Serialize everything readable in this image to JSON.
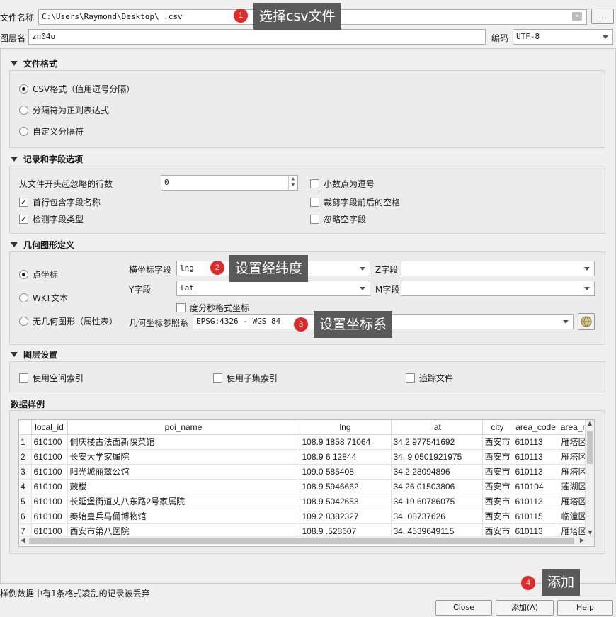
{
  "file_row": {
    "label": "文件名称",
    "path": "C:\\Users\\Raymond\\Desktop\\                 .csv",
    "browse_label": "…"
  },
  "layer_row": {
    "label": "图层名",
    "value": "          zn04o",
    "encoding_label": "编码",
    "encoding_value": "UTF-8"
  },
  "file_format": {
    "title": "文件格式",
    "options": [
      "CSV格式（值用逗号分隔）",
      "分隔符为正则表达式",
      "自定义分隔符"
    ],
    "selected": 0
  },
  "record_options": {
    "title": "记录和字段选项",
    "skip_label": "从文件开头起忽略的行数",
    "skip_value": "0",
    "first_row_header": "首行包含字段名称",
    "detect_types": "检测字段类型",
    "decimal_comma": "小数点为逗号",
    "trim_fields": "裁剪字段前后的空格",
    "discard_empty": "忽略空字段"
  },
  "geometry": {
    "title": "几何图形定义",
    "point_label": "点坐标",
    "wkt_label": "WKT文本",
    "none_label": "无几何图形（属性表）",
    "x_label": "横坐标字段",
    "x_value": "lng",
    "y_label": "Y字段",
    "y_value": "lat",
    "z_label": "Z字段",
    "m_label": "M字段",
    "dms_label": "度分秒格式坐标",
    "crs_label": "几何坐标参照系",
    "crs_value": "EPSG:4326 - WGS 84"
  },
  "layer_settings": {
    "title": "图层设置",
    "spatial_index": "使用空间索引",
    "subset_index": "使用子集索引",
    "watch_file": "追踪文件"
  },
  "sample": {
    "title": "数据样例",
    "columns": [
      "",
      "local_id",
      "poi_name",
      "lng",
      "lat",
      "city",
      "area_code",
      "area_n"
    ],
    "rows": [
      [
        "1",
        "610100",
        "侗庆楼古法面新陕菜馆",
        "108.9   1858  71064",
        "34.2    977541692",
        "西安市",
        "610113",
        "雁塔区"
      ],
      [
        "2",
        "610100",
        "长安大学家属院",
        "108.9      6  12844",
        "34.   9  0501921975",
        "西安市",
        "610113",
        "雁塔区"
      ],
      [
        "3",
        "610100",
        "阳光城丽兹公馆",
        "109.0     585408",
        "34.2    28094896",
        "西安市",
        "610113",
        "雁塔区"
      ],
      [
        "4",
        "610100",
        "鼓楼",
        "108.9     5946662",
        "34.26   01503806",
        "西安市",
        "610104",
        "莲湖区"
      ],
      [
        "5",
        "610100",
        "长延堡街道丈八东路2号家属院",
        "108.9     5042653",
        "34.19    60786075",
        "西安市",
        "610113",
        "雁塔区"
      ],
      [
        "6",
        "610100",
        "秦始皇兵马俑博物馆",
        "109.2     8382327",
        "34.    08737626",
        "西安市",
        "610115",
        "临潼区"
      ],
      [
        "7",
        "610100",
        "西安市第八医院",
        "108.9     .528607",
        "34.    4539649115",
        "西安市",
        "610113",
        "雁塔区"
      ]
    ]
  },
  "status_text": "样例数据中有1条格式凌乱的记录被丢弃",
  "buttons": {
    "close": "Close",
    "add": "添加(A)",
    "help": "Help"
  },
  "annotations": [
    {
      "num": "1",
      "text": "选择csv文件"
    },
    {
      "num": "2",
      "text": "设置经纬度"
    },
    {
      "num": "3",
      "text": "设置坐标系"
    },
    {
      "num": "4",
      "text": "添加"
    }
  ]
}
